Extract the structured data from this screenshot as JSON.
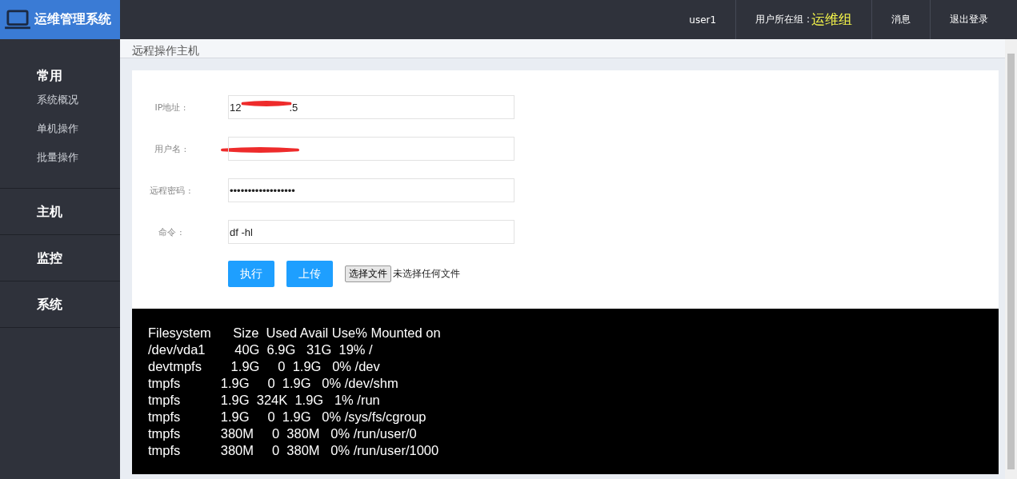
{
  "header": {
    "app_title": "运维管理系统",
    "user": "user1",
    "group_label": "用户所在组 :",
    "group_name": "运维组",
    "links": [
      "消息",
      "退出登录"
    ]
  },
  "sidebar": {
    "groups": [
      {
        "title": "常用",
        "items": [
          {
            "label": "系统概况",
            "selected": false
          },
          {
            "label": "单机操作",
            "selected": false
          },
          {
            "label": "批量操作",
            "selected": false
          }
        ]
      },
      {
        "title": "主机"
      },
      {
        "title": "监控"
      },
      {
        "title": "系统"
      }
    ]
  },
  "page_title": "远程操作主机",
  "form": {
    "fields": [
      {
        "label": "IP地址 :",
        "value_start": "12",
        "value_end": ".5",
        "redacted": true
      },
      {
        "label": "用户名 :",
        "redacted": true
      },
      {
        "label": "远程密码 :",
        "value_start": "••••••••••••••••••"
      },
      {
        "label": "命令 :",
        "value_start": "df -hl"
      }
    ],
    "buttons": [
      "执行",
      "上传"
    ],
    "file_button": "选择文件",
    "file_status": "未选择任何文件"
  },
  "terminal": {
    "lines": [
      "Filesystem      Size  Used Avail Use% Mounted on",
      "/dev/vda1        40G  6.9G   31G  19% /",
      "devtmpfs        1.9G     0  1.9G   0% /dev",
      "tmpfs           1.9G     0  1.9G   0% /dev/shm",
      "tmpfs           1.9G  324K  1.9G   1% /run",
      "tmpfs           1.9G     0  1.9G   0% /sys/fs/cgroup",
      "tmpfs           380M     0  380M   0% /run/user/0",
      "tmpfs           380M     0  380M   0% /run/user/1000"
    ]
  }
}
